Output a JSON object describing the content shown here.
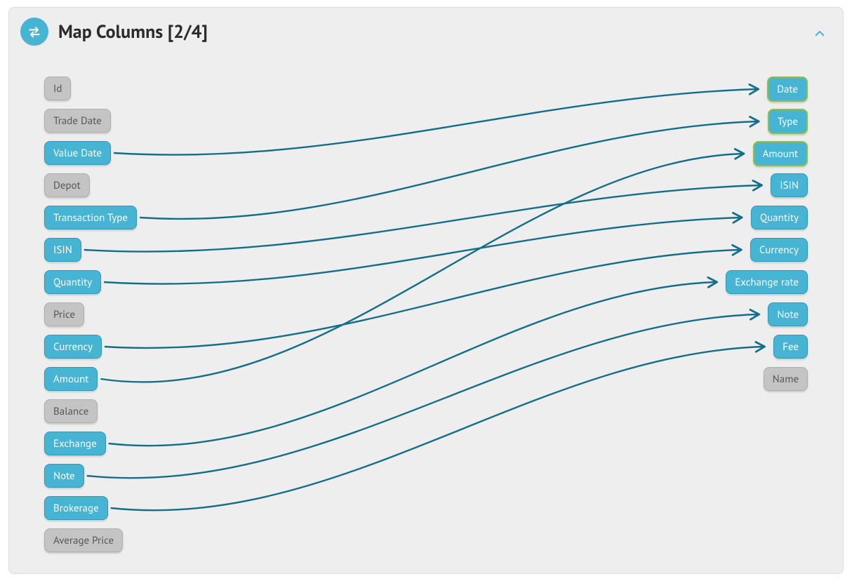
{
  "panel": {
    "title": "Map Columns [2/4]"
  },
  "colors": {
    "accent": "#47b4d4",
    "link": "#146e89",
    "required": "#8fbf3f"
  },
  "leftColumns": [
    {
      "id": "Id",
      "label": "Id",
      "mapped": false
    },
    {
      "id": "TradeDate",
      "label": "Trade Date",
      "mapped": false
    },
    {
      "id": "ValueDate",
      "label": "Value Date",
      "mapped": true
    },
    {
      "id": "Depot",
      "label": "Depot",
      "mapped": false
    },
    {
      "id": "TransactionType",
      "label": "Transaction Type",
      "mapped": true
    },
    {
      "id": "ISIN",
      "label": "ISIN",
      "mapped": true
    },
    {
      "id": "Quantity",
      "label": "Quantity",
      "mapped": true
    },
    {
      "id": "Price",
      "label": "Price",
      "mapped": false
    },
    {
      "id": "Currency",
      "label": "Currency",
      "mapped": true
    },
    {
      "id": "Amount",
      "label": "Amount",
      "mapped": true
    },
    {
      "id": "Balance",
      "label": "Balance",
      "mapped": false
    },
    {
      "id": "Exchange",
      "label": "Exchange",
      "mapped": true
    },
    {
      "id": "Note",
      "label": "Note",
      "mapped": true
    },
    {
      "id": "Brokerage",
      "label": "Brokerage",
      "mapped": true
    },
    {
      "id": "AveragePrice",
      "label": "Average Price",
      "mapped": false
    }
  ],
  "rightColumns": [
    {
      "id": "Date",
      "label": "Date",
      "mapped": true,
      "required": true
    },
    {
      "id": "Type",
      "label": "Type",
      "mapped": true,
      "required": true
    },
    {
      "id": "Amount",
      "label": "Amount",
      "mapped": true,
      "required": true
    },
    {
      "id": "ISIN",
      "label": "ISIN",
      "mapped": true,
      "required": false
    },
    {
      "id": "Quantity",
      "label": "Quantity",
      "mapped": true,
      "required": false
    },
    {
      "id": "Currency",
      "label": "Currency",
      "mapped": true,
      "required": false
    },
    {
      "id": "ExchangeRate",
      "label": "Exchange rate",
      "mapped": true,
      "required": false
    },
    {
      "id": "Note",
      "label": "Note",
      "mapped": true,
      "required": false
    },
    {
      "id": "Fee",
      "label": "Fee",
      "mapped": true,
      "required": false
    },
    {
      "id": "Name",
      "label": "Name",
      "mapped": false,
      "required": false
    }
  ],
  "mappings": [
    {
      "from": "ValueDate",
      "to": "Date"
    },
    {
      "from": "TransactionType",
      "to": "Type"
    },
    {
      "from": "Amount",
      "to": "Amount"
    },
    {
      "from": "ISIN",
      "to": "ISIN"
    },
    {
      "from": "Quantity",
      "to": "Quantity"
    },
    {
      "from": "Currency",
      "to": "Currency"
    },
    {
      "from": "Exchange",
      "to": "ExchangeRate"
    },
    {
      "from": "Note",
      "to": "Note"
    },
    {
      "from": "Brokerage",
      "to": "Fee"
    }
  ]
}
